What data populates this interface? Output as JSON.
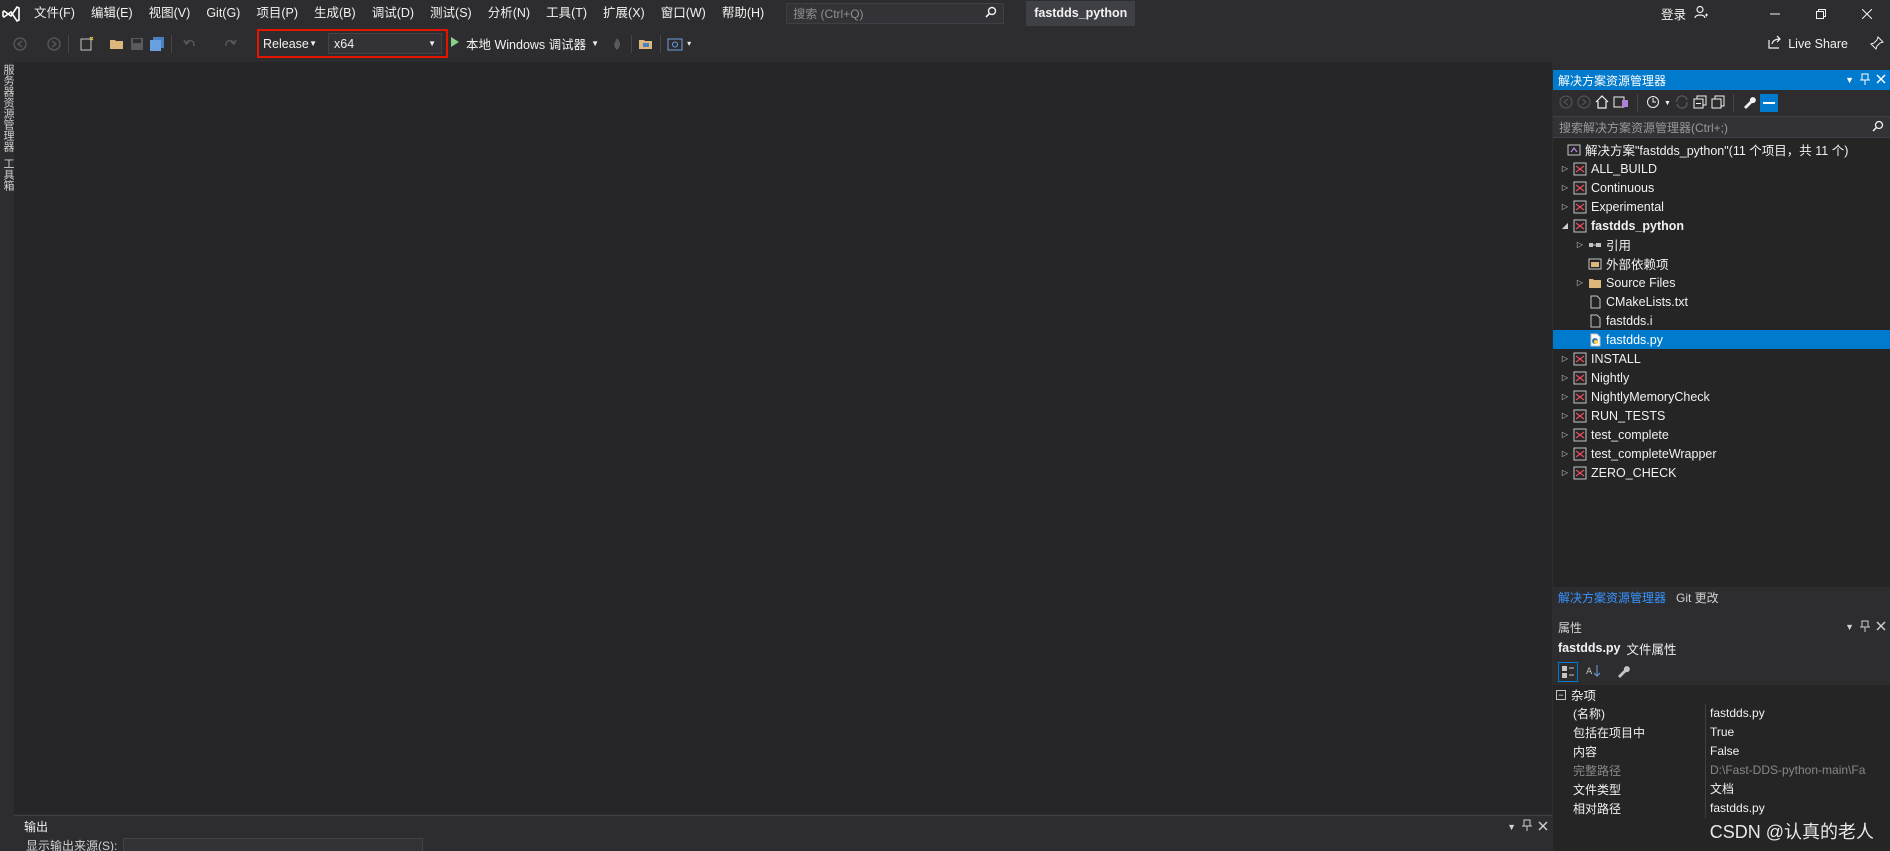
{
  "titlebar": {
    "menu": [
      "文件(F)",
      "编辑(E)",
      "视图(V)",
      "Git(G)",
      "项目(P)",
      "生成(B)",
      "调试(D)",
      "测试(S)",
      "分析(N)",
      "工具(T)",
      "扩展(X)",
      "窗口(W)",
      "帮助(H)"
    ],
    "search_placeholder": "搜索 (Ctrl+Q)",
    "solution_name": "fastdds_python",
    "signin": "登录"
  },
  "toolbar": {
    "configuration": "Release",
    "platform": "x64",
    "run_label": "本地 Windows 调试器",
    "live_share": "Live Share"
  },
  "left_tabs": [
    "服务器资源管理器",
    "工具箱"
  ],
  "solution_explorer": {
    "title": "解决方案资源管理器",
    "search_placeholder": "搜索解决方案资源管理器(Ctrl+;)",
    "solution_label": "解决方案\"fastdds_python\"(11 个项目，共 11 个)",
    "items": [
      {
        "label": "ALL_BUILD",
        "level": 0,
        "expander": "collapsed",
        "icon": "project"
      },
      {
        "label": "Continuous",
        "level": 0,
        "expander": "collapsed",
        "icon": "project"
      },
      {
        "label": "Experimental",
        "level": 0,
        "expander": "collapsed",
        "icon": "project"
      },
      {
        "label": "fastdds_python",
        "level": 0,
        "expander": "expanded",
        "icon": "project",
        "bold": true
      },
      {
        "label": "引用",
        "level": 1,
        "expander": "collapsed",
        "icon": "references"
      },
      {
        "label": "外部依赖项",
        "level": 1,
        "expander": "none",
        "icon": "external"
      },
      {
        "label": "Source Files",
        "level": 1,
        "expander": "collapsed",
        "icon": "folder"
      },
      {
        "label": "CMakeLists.txt",
        "level": 1,
        "expander": "none",
        "icon": "file"
      },
      {
        "label": "fastdds.i",
        "level": 1,
        "expander": "none",
        "icon": "file"
      },
      {
        "label": "fastdds.py",
        "level": 1,
        "expander": "none",
        "icon": "py-file",
        "selected": true
      },
      {
        "label": "INSTALL",
        "level": 0,
        "expander": "collapsed",
        "icon": "project"
      },
      {
        "label": "Nightly",
        "level": 0,
        "expander": "collapsed",
        "icon": "project"
      },
      {
        "label": "NightlyMemoryCheck",
        "level": 0,
        "expander": "collapsed",
        "icon": "project"
      },
      {
        "label": "RUN_TESTS",
        "level": 0,
        "expander": "collapsed",
        "icon": "project"
      },
      {
        "label": "test_complete",
        "level": 0,
        "expander": "collapsed",
        "icon": "project"
      },
      {
        "label": "test_completeWrapper",
        "level": 0,
        "expander": "collapsed",
        "icon": "project"
      },
      {
        "label": "ZERO_CHECK",
        "level": 0,
        "expander": "collapsed",
        "icon": "project"
      }
    ],
    "tabs": [
      "解决方案资源管理器",
      "Git 更改"
    ]
  },
  "properties": {
    "title": "属性",
    "object_name": "fastdds.py",
    "object_type": "文件属性",
    "category": "杂项",
    "rows": [
      {
        "name": "(名称)",
        "value": "fastdds.py"
      },
      {
        "name": "包括在项目中",
        "value": "True"
      },
      {
        "name": "内容",
        "value": "False"
      },
      {
        "name": "完整路径",
        "value": "D:\\Fast-DDS-python-main\\Fa",
        "dim": true
      },
      {
        "name": "文件类型",
        "value": "文档"
      },
      {
        "name": "相对路径",
        "value": "fastdds.py"
      }
    ]
  },
  "output": {
    "title": "输出",
    "source_label": "显示输出来源(S):"
  },
  "watermark": "CSDN @认真的老人",
  "colors": {
    "accent": "#007acc",
    "highlight_box": "#e51400",
    "background": "#2d2d30"
  }
}
